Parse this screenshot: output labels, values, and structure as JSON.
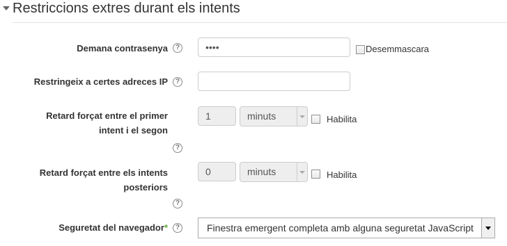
{
  "section": {
    "title": "Restriccions extres durant els intents"
  },
  "help_glyph": "?",
  "password": {
    "label": "Demana contrasenya",
    "value": "••••",
    "unmask_label": "Desemmascara"
  },
  "ip": {
    "label": "Restringeix a certes adreces IP",
    "value": ""
  },
  "delay1": {
    "label_line1": "Retard forçat entre el primer",
    "label_line2": "intent i el segon",
    "value": "1",
    "unit": "minuts",
    "enable_label": "Habilita"
  },
  "delay2": {
    "label_line1": "Retard forçat entre els intents",
    "label_line2": "posteriors",
    "value": "0",
    "unit": "minuts",
    "enable_label": "Habilita"
  },
  "browser_security": {
    "label": "Seguretat del navegador",
    "required_mark": "*",
    "value": "Finestra emergent completa amb alguna seguretat JavaScript"
  }
}
